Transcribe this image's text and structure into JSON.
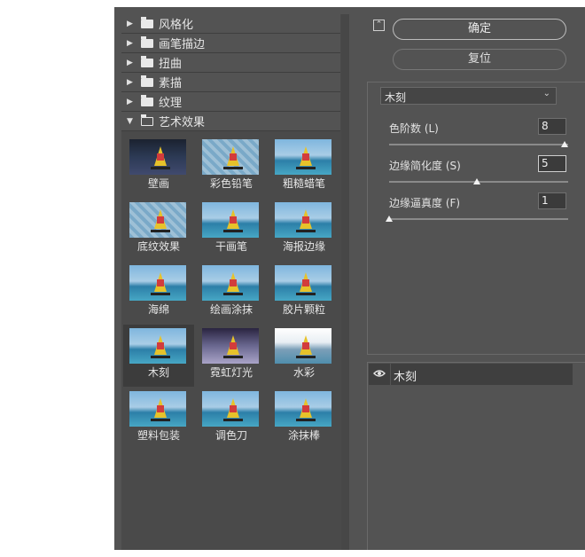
{
  "left_panel": {
    "folders": [
      {
        "label": "风格化",
        "open": false
      },
      {
        "label": "画笔描边",
        "open": false
      },
      {
        "label": "扭曲",
        "open": false
      },
      {
        "label": "素描",
        "open": false
      },
      {
        "label": "纹理",
        "open": false
      },
      {
        "label": "艺术效果",
        "open": true
      }
    ],
    "thumbnails": [
      {
        "label": "壁画"
      },
      {
        "label": "彩色铅笔"
      },
      {
        "label": "粗糙蜡笔"
      },
      {
        "label": "底纹效果"
      },
      {
        "label": "干画笔"
      },
      {
        "label": "海报边缘"
      },
      {
        "label": "海绵"
      },
      {
        "label": "绘画涂抹"
      },
      {
        "label": "胶片颗粒"
      },
      {
        "label": "木刻",
        "selected": true
      },
      {
        "label": "霓虹灯光"
      },
      {
        "label": "水彩"
      },
      {
        "label": "塑料包装"
      },
      {
        "label": "调色刀"
      },
      {
        "label": "涂抹棒"
      }
    ]
  },
  "right_panel": {
    "collapse_icon": "chevron-up-icon",
    "ok_label": "确定",
    "reset_label": "复位",
    "filter_select": {
      "value": "木刻"
    },
    "params": [
      {
        "label": "色阶数 (L)",
        "value": "8",
        "fraction": 1.0
      },
      {
        "label": "边缘简化度 (S)",
        "value": "5",
        "fraction": 0.5
      },
      {
        "label": "边缘逼真度 (F)",
        "value": "1",
        "fraction": 0.0
      }
    ],
    "layer": {
      "name": "木刻",
      "visible_icon": "eye-icon"
    }
  }
}
